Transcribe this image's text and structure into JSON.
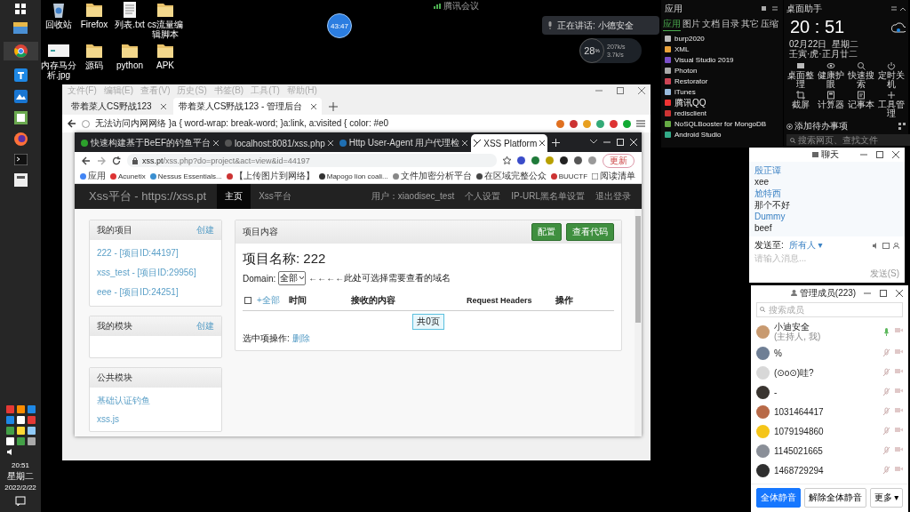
{
  "taskbar": {
    "clock_time": "20:51",
    "clock_day": "星期二",
    "clock_date": "2022/2/22"
  },
  "desktop_icons": [
    {
      "label": "回收站",
      "kind": "bin"
    },
    {
      "label": "Firefox",
      "kind": "folder"
    },
    {
      "label": "列表.txt",
      "kind": "file"
    },
    {
      "label": "cs流量编辑脚本",
      "kind": "folder"
    },
    {
      "label": "内存马分析.jpg",
      "kind": "image"
    },
    {
      "label": "源码",
      "kind": "folder"
    },
    {
      "label": "python",
      "kind": "folder"
    },
    {
      "label": "APK",
      "kind": "folder"
    }
  ],
  "hud": {
    "timer": "43:47",
    "meeting": "腾讯会议",
    "speaking": "正在讲话: 小德安全",
    "network": {
      "percent": "28",
      "unit": "%",
      "up": "207k/s",
      "down": "3.7k/s"
    }
  },
  "outer_browser": {
    "menu": [
      "文件(F)",
      "编辑(E)",
      "查看(V)",
      "历史(S)",
      "书签(B)",
      "工具(T)",
      "帮助(H)"
    ],
    "tabs": [
      {
        "label": "带着菜人CS野战123",
        "selected": false
      },
      {
        "label": "带着菜人CS野战123 - 管理后台",
        "selected": true
      }
    ],
    "address": "无法访问内网网络   }a { word-wrap: break-word; }a:link, a:visited { color: #e0"
  },
  "inner_browser": {
    "tabs": [
      {
        "label": "快速构建基于BeEF的钓鱼平台",
        "selected": false
      },
      {
        "label": "localhost:8081/xss.php",
        "selected": false
      },
      {
        "label": "Http User-Agent 用户代理检",
        "selected": false
      },
      {
        "label": "XSS Platform",
        "selected": true
      }
    ],
    "url_host": "xss.pt",
    "url_path": "/xss.php?do=project&act=view&id=44197",
    "update_button": "更新",
    "bookmarks": [
      "应用",
      "Acunetix",
      "Nessus Essentials...",
      "【上传图片到网络】",
      "Mapogo lion coali...",
      "文件加密分析平台",
      "在区域完整公众",
      "BUUCTF"
    ],
    "reading_list": "阅读清单"
  },
  "site": {
    "brand": "Xss平台 - https://xss.pt",
    "nav": [
      {
        "label": "主页",
        "selected": true
      },
      {
        "label": "Xss平台",
        "selected": false
      }
    ],
    "user": "用户：xiaodisec_test",
    "user_links": [
      "个人设置",
      "IP-URL黑名单设置",
      "退出登录"
    ],
    "sidebar": [
      {
        "title": "我的项目",
        "action": "创建",
        "items": [
          "222 - [项目ID:44197]",
          "xss_test - [项目ID:29956]",
          "eee - [项目ID:24251]"
        ]
      },
      {
        "title": "我的模块",
        "action": "创建"
      },
      {
        "title": "公共模块",
        "items": [
          "基础认证钓鱼",
          "xss.js"
        ]
      }
    ],
    "panel": {
      "title": "项目内容",
      "buttons": [
        "配置",
        "查看代码"
      ],
      "heading": "项目名称: 222",
      "domain_label": "Domain:",
      "domain_value": "全部",
      "domain_hint": "←←←←此处可选择需要查看的域名",
      "select_all_checked": false,
      "columns": [
        "+全部",
        "时间",
        "接收的内容",
        "Request Headers",
        "操作"
      ],
      "pager": "共0页",
      "bulk_label": "选中项操作:",
      "bulk_action": "删除"
    }
  },
  "apps_panel": {
    "title": "应用",
    "tabs": [
      {
        "label": "应用",
        "selected": true
      },
      {
        "label": "图片",
        "selected": false
      },
      {
        "label": "文档",
        "selected": false
      },
      {
        "label": "目录",
        "selected": false
      },
      {
        "label": "其它",
        "selected": false
      },
      {
        "label": "压缩",
        "selected": false
      }
    ],
    "items": [
      "burp2020",
      "XML",
      "Visual Studio 2019",
      "Photon",
      "Restorator",
      "iTunes",
      "腾讯QQ",
      "redisclient",
      "NoSQLBooster for MongoDB",
      "Android Studio"
    ]
  },
  "assistant": {
    "title": "桌面助手",
    "time": "20 : 51",
    "date": "02月22日",
    "weekday": "星期二",
    "lunar": "壬寅·虎·正月廿二",
    "tools": [
      "桌面整理",
      "健康护眼",
      "快速搜索",
      "定时关机",
      "截屏",
      "计算器",
      "记事本",
      "工具管理"
    ],
    "todo": "添加待办事项",
    "search_placeholder": "搜索网页、查找文件"
  },
  "chat": {
    "title": "聊天",
    "messages": [
      {
        "sender": "殷正谭",
        "text": "xee"
      },
      {
        "sender": "尬特西",
        "text": "那个不好"
      },
      {
        "sender": "Dummy",
        "text": "beef"
      }
    ],
    "send_to_label": "发送至:",
    "send_to": "所有人 ▾",
    "placeholder": "请输入消息...",
    "send_button": "发送(S)"
  },
  "members": {
    "title": "管理成员(223)",
    "search_placeholder": "搜索成员",
    "list": [
      {
        "name": "小迪安全",
        "role": "(主持人, 我)",
        "muted": false,
        "color": "#c89a70"
      },
      {
        "name": "%",
        "muted": true,
        "color": "#6f7f95"
      },
      {
        "name": "(⊙o⊙)哇?",
        "muted": true,
        "color": "#d8d8d8"
      },
      {
        "name": "-",
        "muted": true,
        "color": "#3a3530"
      },
      {
        "name": "1031464417",
        "muted": true,
        "color": "#b86a48"
      },
      {
        "name": "1079194860",
        "muted": true,
        "color": "#f5c518"
      },
      {
        "name": "1145021665",
        "muted": true,
        "color": "#8a8f98"
      },
      {
        "name": "1468729294",
        "muted": true,
        "color": "#2f2f2f"
      }
    ],
    "buttons": [
      "全体静音",
      "解除全体静音",
      "更多 ▾"
    ]
  }
}
